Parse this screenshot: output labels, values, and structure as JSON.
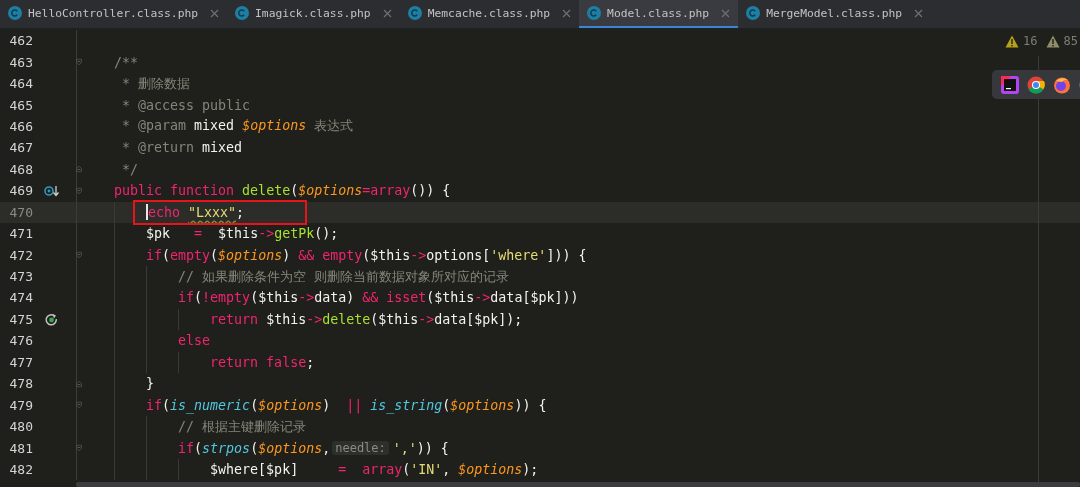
{
  "tabs": [
    {
      "label": "HelloController.class.php",
      "selected": false
    },
    {
      "label": "Imagick.class.php",
      "selected": false
    },
    {
      "label": "Memcache.class.php",
      "selected": false
    },
    {
      "label": "Model.class.php",
      "selected": true
    },
    {
      "label": "MergeModel.class.php",
      "selected": false
    }
  ],
  "inspections": [
    {
      "kind": "warning",
      "count": "16"
    },
    {
      "kind": "weak_warning",
      "count": "85"
    }
  ],
  "app_switcher": [
    {
      "kind": "phpstorm"
    },
    {
      "kind": "chrome"
    },
    {
      "kind": "firefox"
    },
    {
      "kind": "partial"
    }
  ],
  "lines": [
    {
      "number": "462",
      "current": false,
      "boxed": false
    },
    {
      "number": "463",
      "current": false,
      "boxed": false,
      "fold": {
        "kind": "start"
      },
      "tokens": [
        {
          "kind": "comment",
          "text": "/**"
        }
      ]
    },
    {
      "number": "464",
      "current": false,
      "boxed": false,
      "tokens": [
        {
          "kind": "comment",
          "text": " * 删除数据"
        }
      ]
    },
    {
      "number": "465",
      "current": false,
      "boxed": false,
      "tokens": [
        {
          "kind": "comment",
          "text": " * @access public"
        }
      ]
    },
    {
      "number": "466",
      "current": false,
      "boxed": false,
      "tokens": [
        {
          "kind": "comment",
          "text": " * @param "
        },
        {
          "kind": "plain",
          "text": "mixed "
        },
        {
          "kind": "var",
          "text": "$options"
        },
        {
          "kind": "comment",
          "text": " 表达式"
        }
      ]
    },
    {
      "number": "467",
      "current": false,
      "boxed": false,
      "tokens": [
        {
          "kind": "comment",
          "text": " * @return "
        },
        {
          "kind": "plain",
          "text": "mixed"
        }
      ]
    },
    {
      "number": "468",
      "current": false,
      "boxed": false,
      "fold": {
        "kind": "end"
      },
      "tokens": [
        {
          "kind": "comment",
          "text": " */"
        }
      ]
    },
    {
      "number": "469",
      "current": false,
      "boxed": false,
      "fold": {
        "kind": "start"
      },
      "gutter": {
        "kind": "override"
      },
      "tokens": [
        {
          "kind": "keyword",
          "text": "public function "
        },
        {
          "kind": "function",
          "text": "delete"
        },
        {
          "kind": "plain",
          "text": "("
        },
        {
          "kind": "var",
          "text": "$options"
        },
        {
          "kind": "keyword",
          "text": "=array"
        },
        {
          "kind": "plain",
          "text": "()) {"
        }
      ],
      "children": [
        {
          "number": "470",
          "current": true,
          "boxed": true,
          "tokens": [
            {
              "kind": "keyword",
              "text": "echo "
            },
            {
              "kind": "string",
              "text": "\"Lxxx\"",
              "typo": true
            },
            {
              "kind": "plain",
              "text": ";"
            }
          ]
        },
        {
          "number": "471",
          "current": false,
          "boxed": false,
          "tokens": [
            {
              "kind": "plain",
              "text": "$pk   "
            },
            {
              "kind": "keyword",
              "text": "="
            },
            {
              "kind": "plain",
              "text": "  $this"
            },
            {
              "kind": "keyword",
              "text": "->"
            },
            {
              "kind": "function",
              "text": "getPk"
            },
            {
              "kind": "plain",
              "text": "();"
            }
          ]
        },
        {
          "number": "472",
          "current": false,
          "boxed": false,
          "fold": {
            "kind": "start"
          },
          "tokens": [
            {
              "kind": "keyword",
              "text": "if"
            },
            {
              "kind": "plain",
              "text": "("
            },
            {
              "kind": "keyword",
              "text": "empty"
            },
            {
              "kind": "plain",
              "text": "("
            },
            {
              "kind": "var",
              "text": "$options"
            },
            {
              "kind": "plain",
              "text": ") "
            },
            {
              "kind": "keyword",
              "text": "&& empty"
            },
            {
              "kind": "plain",
              "text": "($this"
            },
            {
              "kind": "keyword",
              "text": "->"
            },
            {
              "kind": "plain",
              "text": "options["
            },
            {
              "kind": "string",
              "text": "'where'"
            },
            {
              "kind": "plain",
              "text": "])) {"
            }
          ],
          "children": [
            {
              "number": "473",
              "current": false,
              "boxed": false,
              "tokens": [
                {
                  "kind": "comment",
                  "text": "// 如果删除条件为空 则删除当前数据对象所对应的记录"
                }
              ]
            },
            {
              "number": "474",
              "current": false,
              "boxed": false,
              "tokens": [
                {
                  "kind": "keyword",
                  "text": "if"
                },
                {
                  "kind": "plain",
                  "text": "("
                },
                {
                  "kind": "keyword",
                  "text": "!empty"
                },
                {
                  "kind": "plain",
                  "text": "($this"
                },
                {
                  "kind": "keyword",
                  "text": "->"
                },
                {
                  "kind": "plain",
                  "text": "data) "
                },
                {
                  "kind": "keyword",
                  "text": "&& isset"
                },
                {
                  "kind": "plain",
                  "text": "($this"
                },
                {
                  "kind": "keyword",
                  "text": "->"
                },
                {
                  "kind": "plain",
                  "text": "data[$pk]))"
                }
              ],
              "children": [
                {
                  "number": "475",
                  "current": false,
                  "boxed": false,
                  "gutter": {
                    "kind": "recursion"
                  },
                  "tokens": [
                    {
                      "kind": "keyword",
                      "text": "return"
                    },
                    {
                      "kind": "plain",
                      "text": " $this"
                    },
                    {
                      "kind": "keyword",
                      "text": "->"
                    },
                    {
                      "kind": "function",
                      "text": "delete"
                    },
                    {
                      "kind": "plain",
                      "text": "($this"
                    },
                    {
                      "kind": "keyword",
                      "text": "->"
                    },
                    {
                      "kind": "plain",
                      "text": "data[$pk]);"
                    }
                  ]
                }
              ]
            },
            {
              "number": "476",
              "current": false,
              "boxed": false,
              "tokens": [
                {
                  "kind": "keyword",
                  "text": "else"
                }
              ],
              "children": [
                {
                  "number": "477",
                  "current": false,
                  "boxed": false,
                  "tokens": [
                    {
                      "kind": "keyword",
                      "text": "return false"
                    },
                    {
                      "kind": "plain",
                      "text": ";"
                    }
                  ]
                }
              ]
            }
          ]
        },
        {
          "number": "478",
          "current": false,
          "boxed": false,
          "fold": {
            "kind": "end"
          },
          "tokens": [
            {
              "kind": "plain",
              "text": "}"
            }
          ]
        },
        {
          "number": "479",
          "current": false,
          "boxed": false,
          "fold": {
            "kind": "start"
          },
          "tokens": [
            {
              "kind": "keyword",
              "text": "if"
            },
            {
              "kind": "plain",
              "text": "("
            },
            {
              "kind": "builtin",
              "text": "is_numeric"
            },
            {
              "kind": "plain",
              "text": "("
            },
            {
              "kind": "var",
              "text": "$options"
            },
            {
              "kind": "plain",
              "text": ")  "
            },
            {
              "kind": "keyword",
              "text": "|| "
            },
            {
              "kind": "builtin",
              "text": "is_string"
            },
            {
              "kind": "plain",
              "text": "("
            },
            {
              "kind": "var",
              "text": "$options"
            },
            {
              "kind": "plain",
              "text": ")) {"
            }
          ],
          "children": [
            {
              "number": "480",
              "current": false,
              "boxed": false,
              "tokens": [
                {
                  "kind": "comment",
                  "text": "// 根据主键删除记录"
                }
              ]
            },
            {
              "number": "481",
              "current": false,
              "boxed": false,
              "fold": {
                "kind": "start"
              },
              "tokens": [
                {
                  "kind": "keyword",
                  "text": "if"
                },
                {
                  "kind": "plain",
                  "text": "("
                },
                {
                  "kind": "builtin",
                  "text": "strpos"
                },
                {
                  "kind": "plain",
                  "text": "("
                },
                {
                  "kind": "var",
                  "text": "$options"
                },
                {
                  "kind": "plain",
                  "text": ","
                },
                {
                  "kind": "hint",
                  "text": "needle:"
                },
                {
                  "kind": "string",
                  "text": "','"
                },
                {
                  "kind": "plain",
                  "text": ")) {"
                }
              ],
              "children": [
                {
                  "number": "482",
                  "current": false,
                  "boxed": false,
                  "tokens": [
                    {
                      "kind": "plain",
                      "text": "$where[$pk]     "
                    },
                    {
                      "kind": "keyword",
                      "text": "=  array"
                    },
                    {
                      "kind": "plain",
                      "text": "("
                    },
                    {
                      "kind": "string",
                      "text": "'IN'"
                    },
                    {
                      "kind": "plain",
                      "text": ", "
                    },
                    {
                      "kind": "var",
                      "text": "$options"
                    },
                    {
                      "kind": "plain",
                      "text": ");"
                    }
                  ]
                }
              ]
            }
          ]
        }
      ]
    }
  ]
}
